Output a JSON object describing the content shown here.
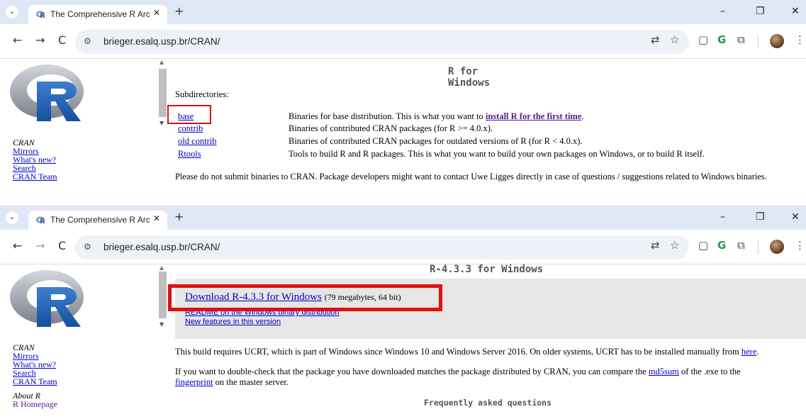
{
  "browser": {
    "tab_title": "The Comprehensive R Archive N",
    "tab_close": "✕",
    "new_tab": "+",
    "tab_list": "⌄",
    "minimize": "–",
    "restore": "❐",
    "close": "✕",
    "back": "←",
    "forward": "→",
    "reload": "C",
    "site_info": "⚙",
    "url": "brieger.esalq.usp.br/CRAN/",
    "menu": "⋮"
  },
  "sidebar": {
    "cran_label": "CRAN",
    "links": [
      "Mirrors",
      "What's new?",
      "Search",
      "CRAN Team"
    ],
    "about_label": "About R",
    "homepage": "R Homepage"
  },
  "page1": {
    "heading": "R for Windows",
    "subdirectories_label": "Subdirectories:",
    "rows": [
      {
        "link": "base",
        "desc": "Binaries for base distribution. This is what you want to ",
        "desc_link": "install R for the first time",
        "desc_end": "."
      },
      {
        "link": "contrib",
        "desc": "Binaries of contributed CRAN packages (for R >= 4.0.x)."
      },
      {
        "link": "old contrib",
        "desc": "Binaries of contributed CRAN packages for outdated versions of R (for R < 4.0.x)."
      },
      {
        "link": "Rtools",
        "desc": "Tools to build R and R packages. This is what you want to build your own packages on Windows, or to build R itself."
      }
    ],
    "note": "Please do not submit binaries to CRAN. Package developers might want to contact Uwe Ligges directly in case of questions / suggestions related to Windows binaries."
  },
  "page2": {
    "heading": "R-4.3.3 for Windows",
    "download_link": "Download R-4.3.3 for Windows",
    "download_note": "(79 megabytes, 64 bit)",
    "readme_link": "README on the Windows binary distribution",
    "features_link": "New features in this version",
    "ucrt_text": "This build requires UCRT, which is part of Windows since Windows 10 and Windows Server 2016. On older systems, UCRT has to be installed manually from ",
    "ucrt_link": "here",
    "ucrt_end": ".",
    "check_text": "If you want to double-check that the package you have downloaded matches the package distributed by CRAN, you can compare the ",
    "md5_link": "md5sum",
    "check_text2": " of the .exe to the",
    "fingerprint_link": "fingerprint",
    "check_text3": " on the master server.",
    "faq_heading": "Frequently asked questions"
  },
  "colors": {
    "tabbar_bg": "#dfe6f5",
    "link": "#0000cc",
    "visited": "#551a8b",
    "highlight": "#e01010"
  }
}
